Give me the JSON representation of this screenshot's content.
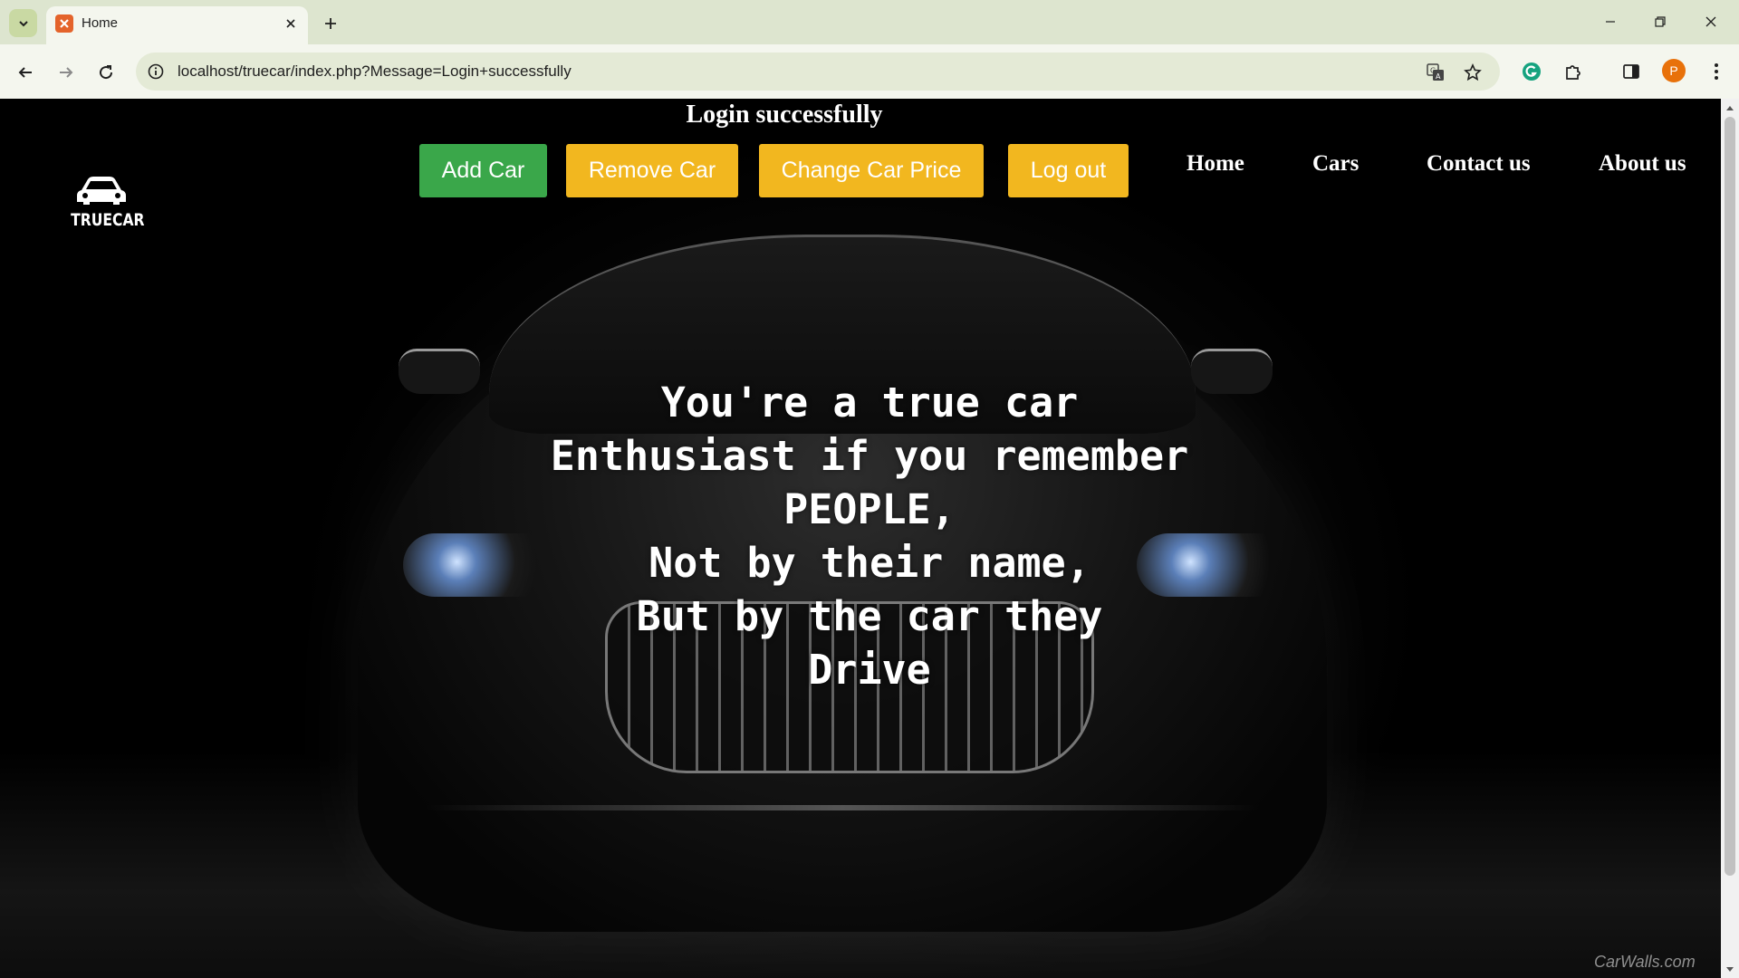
{
  "browser": {
    "tab_title": "Home",
    "url": "localhost/truecar/index.php?Message=Login+successfully",
    "profile_initial": "P",
    "icons": {
      "tab_search": "chevron-down-icon",
      "favicon": "xampp-icon",
      "tab_close": "close-icon",
      "new_tab": "plus-icon",
      "back": "arrow-left-icon",
      "forward": "arrow-right-icon",
      "reload": "reload-icon",
      "site_info": "info-icon",
      "translate": "translate-icon",
      "bookmark": "star-icon",
      "grammarly": "grammarly-icon",
      "extensions": "puzzle-icon",
      "side_panel": "side-panel-icon",
      "menu": "kebab-menu-icon",
      "minimize": "minimize-icon",
      "restore": "restore-icon",
      "close_window": "close-icon"
    },
    "colors": {
      "tabbar": "#dde5cf",
      "toolbar": "#f4f6ee",
      "omnibox": "#e4ead6",
      "avatar": "#e8710a"
    }
  },
  "page": {
    "status_message": "Login successfully",
    "logo_text": "TRUECAR",
    "buttons": {
      "add_car": "Add Car",
      "remove_car": "Remove Car",
      "change_price": "Change Car Price",
      "logout": "Log out"
    },
    "nav": {
      "home": "Home",
      "cars": "Cars",
      "contact": "Contact us",
      "about": "About us"
    },
    "hero_quote": "You're a true car\nEnthusiast if you remember\nPEOPLE,\nNot by their name,\nBut by the car they\nDrive",
    "watermark": "CarWalls.com",
    "colors": {
      "add_button": "#3aa74a",
      "other_buttons": "#f2b71f",
      "background": "#000000",
      "text": "#ffffff"
    }
  }
}
